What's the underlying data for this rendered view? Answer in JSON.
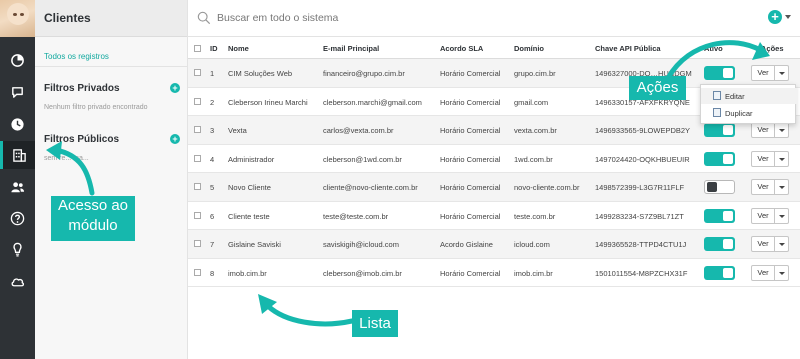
{
  "sidebar": {
    "icons": [
      "chart-pie-icon",
      "chat-icon",
      "clock-icon",
      "building-icon",
      "users-icon",
      "help-icon",
      "lightbulb-icon",
      "cloud-icon"
    ],
    "active_icon": "building-icon"
  },
  "filters": {
    "title": "Clientes",
    "all_records": "Todos os registros",
    "private_title": "Filtros Privados",
    "private_empty": "Nenhum filtro privado encontrado",
    "public_title": "Filtros Públicos",
    "public_note": "sem re... ma..."
  },
  "search": {
    "placeholder": "Buscar em todo o sistema"
  },
  "table": {
    "headers": [
      "ID",
      "Nome",
      "E-mail Principal",
      "Acordo SLA",
      "Domínio",
      "Chave API Pública",
      "Ativo",
      "Ações"
    ],
    "rows": [
      {
        "id": "1",
        "name": "CIM Soluções Web",
        "email": "financeiro@grupo.cim.br",
        "sla": "Horário Comercial",
        "domain": "grupo.cim.br",
        "api": "1496327000-DO…HUNDGM",
        "active": true
      },
      {
        "id": "2",
        "name": "Cleberson Irineu Marchi",
        "email": "cleberson.marchi@gmail.com",
        "sla": "Horário Comercial",
        "domain": "gmail.com",
        "api": "1496330157-AFXFKRYQNE",
        "active": true
      },
      {
        "id": "3",
        "name": "Vexta",
        "email": "carlos@vexta.com.br",
        "sla": "Horário Comercial",
        "domain": "vexta.com.br",
        "api": "1496933565-9LOWEPDB2Y",
        "active": true
      },
      {
        "id": "4",
        "name": "Administrador",
        "email": "cleberson@1wd.com.br",
        "sla": "Horário Comercial",
        "domain": "1wd.com.br",
        "api": "1497024420-OQKHBUEUIR",
        "active": true
      },
      {
        "id": "5",
        "name": "Novo Cliente",
        "email": "cliente@novo-cliente.com.br",
        "sla": "Horário Comercial",
        "domain": "novo-cliente.com.br",
        "api": "1498572399-L3G7R11FLF",
        "active": false
      },
      {
        "id": "6",
        "name": "Cliente teste",
        "email": "teste@teste.com.br",
        "sla": "Horário Comercial",
        "domain": "teste.com.br",
        "api": "1499283234-S7Z9BL71ZT",
        "active": true
      },
      {
        "id": "7",
        "name": "Gislaine Saviski",
        "email": "saviskigih@icloud.com",
        "sla": "Acordo Gislaine",
        "domain": "icloud.com",
        "api": "1499365528-TTPD4CTU1J",
        "active": true
      },
      {
        "id": "8",
        "name": "imob.cim.br",
        "email": "cleberson@imob.cim.br",
        "sla": "Horário Comercial",
        "domain": "imob.cim.br",
        "api": "1501011554-M8PZCHX31F",
        "active": true
      }
    ],
    "view_label": "Ver"
  },
  "dropdown": {
    "edit": "Editar",
    "duplicate": "Duplicar"
  },
  "annotations": {
    "module_access": "Acesso ao módulo",
    "list": "Lista",
    "actions": "Ações"
  },
  "colors": {
    "accent": "#16b8ad",
    "rail": "#2e3236"
  }
}
